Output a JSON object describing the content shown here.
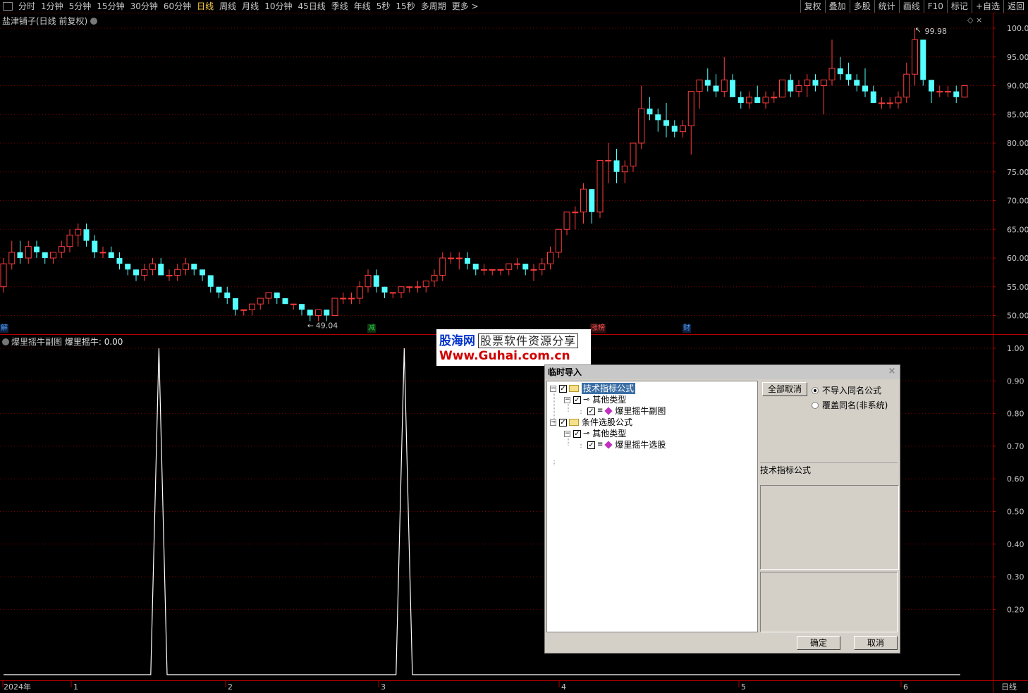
{
  "toolbar": {
    "periods": [
      "分时",
      "1分钟",
      "5分钟",
      "15分钟",
      "30分钟",
      "60分钟",
      "日线",
      "周线",
      "月线",
      "10分钟",
      "45日线",
      "季线",
      "年线",
      "5秒",
      "15秒",
      "多周期",
      "更多 >"
    ],
    "active_period": "日线",
    "right_buttons": [
      "复权",
      "叠加",
      "多股",
      "统计",
      "画线",
      "F10",
      "标记",
      "+自选",
      "返回"
    ]
  },
  "main_chart": {
    "title": "盐津铺子(日线 前复权)",
    "colors": {
      "up": "#ff3c3c",
      "down": "#54ffff",
      "grid": "#7a0000",
      "axis_line": "#b00000"
    },
    "y_ticks": [
      "100.0",
      "95.00",
      "90.00",
      "85.00",
      "80.00",
      "75.00",
      "70.00",
      "65.00",
      "60.00",
      "55.00",
      "50.00"
    ],
    "high_label": "99.98",
    "low_label": "49.04",
    "markers": [
      {
        "text": "解",
        "color": "#4aa0ff"
      },
      {
        "text": "减",
        "color": "#22cc44"
      },
      {
        "text": "涨榜",
        "color": "#ff5050"
      },
      {
        "text": "财",
        "color": "#4aa0ff"
      }
    ]
  },
  "chart_data": [
    {
      "type": "candlestick",
      "title": "盐津铺子(日线 前复权)",
      "ylim": [
        46,
        101
      ],
      "candles_ohlc": [
        [
          55,
          60,
          54,
          59
        ],
        [
          59,
          63,
          58,
          61
        ],
        [
          61,
          63,
          59,
          60
        ],
        [
          60,
          63,
          59,
          62
        ],
        [
          62,
          63,
          60,
          61
        ],
        [
          61,
          61,
          59,
          60
        ],
        [
          60,
          61,
          59,
          61
        ],
        [
          61,
          63,
          60,
          62
        ],
        [
          62,
          65,
          61,
          64
        ],
        [
          64,
          66,
          62,
          65
        ],
        [
          65,
          66,
          62,
          63
        ],
        [
          63,
          64,
          60,
          61
        ],
        [
          61,
          62,
          60,
          61
        ],
        [
          61,
          62,
          60,
          60
        ],
        [
          60,
          61,
          58,
          59
        ],
        [
          59,
          59,
          57,
          58
        ],
        [
          58,
          58,
          56,
          57
        ],
        [
          57,
          59,
          56,
          58
        ],
        [
          58,
          60,
          57,
          59
        ],
        [
          59,
          60,
          57,
          57
        ],
        [
          57,
          58,
          56,
          57
        ],
        [
          57,
          59,
          56,
          58
        ],
        [
          58,
          60,
          57,
          59
        ],
        [
          59,
          59,
          57,
          58
        ],
        [
          58,
          58,
          56,
          57
        ],
        [
          57,
          57,
          54,
          55
        ],
        [
          55,
          55,
          53,
          54
        ],
        [
          54,
          55,
          52,
          53
        ],
        [
          53,
          53,
          50,
          51
        ],
        [
          51,
          51,
          50,
          51
        ],
        [
          51,
          52,
          50,
          52
        ],
        [
          52,
          53,
          51,
          53
        ],
        [
          53,
          54,
          52,
          54
        ],
        [
          54,
          54,
          52,
          53
        ],
        [
          53,
          53,
          52,
          52
        ],
        [
          52,
          52,
          51,
          52
        ],
        [
          52,
          52,
          50,
          51
        ],
        [
          51,
          51,
          49,
          50
        ],
        [
          50,
          51,
          49,
          51
        ],
        [
          51,
          51,
          49,
          50
        ],
        [
          50,
          53,
          50,
          53
        ],
        [
          53,
          54,
          52,
          53
        ],
        [
          53,
          54,
          52,
          53
        ],
        [
          53,
          56,
          52,
          55
        ],
        [
          55,
          58,
          54,
          57
        ],
        [
          57,
          58,
          54,
          55
        ],
        [
          55,
          55,
          53,
          54
        ],
        [
          54,
          54,
          53,
          54
        ],
        [
          54,
          55,
          53,
          55
        ],
        [
          55,
          55,
          54,
          55
        ],
        [
          55,
          56,
          54,
          55
        ],
        [
          55,
          56,
          54,
          56
        ],
        [
          56,
          58,
          55,
          57
        ],
        [
          57,
          61,
          56,
          60
        ],
        [
          60,
          61,
          59,
          60
        ],
        [
          60,
          61,
          58,
          60
        ],
        [
          60,
          61,
          58,
          59
        ],
        [
          59,
          59,
          57,
          58
        ],
        [
          58,
          59,
          57,
          58
        ],
        [
          58,
          58,
          57,
          58
        ],
        [
          58,
          58,
          57,
          58
        ],
        [
          58,
          59,
          57,
          59
        ],
        [
          59,
          60,
          58,
          59
        ],
        [
          59,
          59,
          57,
          58
        ],
        [
          58,
          59,
          56,
          58
        ],
        [
          58,
          60,
          57,
          59
        ],
        [
          59,
          62,
          58,
          61
        ],
        [
          61,
          65,
          60,
          65
        ],
        [
          65,
          68,
          64,
          68
        ],
        [
          68,
          69,
          65,
          68
        ],
        [
          68,
          73,
          66,
          72
        ],
        [
          72,
          72,
          66,
          68
        ],
        [
          68,
          77,
          67,
          77
        ],
        [
          77,
          80,
          73,
          77
        ],
        [
          77,
          79,
          73,
          75
        ],
        [
          75,
          77,
          73,
          76
        ],
        [
          76,
          80,
          75,
          80
        ],
        [
          80,
          90,
          79,
          86
        ],
        [
          86,
          88,
          84,
          85
        ],
        [
          85,
          86,
          82,
          84
        ],
        [
          84,
          87,
          81,
          83
        ],
        [
          83,
          84,
          81,
          82
        ],
        [
          82,
          84,
          81,
          83
        ],
        [
          83,
          89,
          78,
          89
        ],
        [
          89,
          91,
          86,
          91
        ],
        [
          91,
          93,
          89,
          90
        ],
        [
          90,
          92,
          88,
          89
        ],
        [
          89,
          95,
          88,
          91
        ],
        [
          91,
          92,
          88,
          88
        ],
        [
          88,
          89,
          86,
          87
        ],
        [
          87,
          89,
          86,
          88
        ],
        [
          88,
          90,
          87,
          87
        ],
        [
          87,
          89,
          86,
          88
        ],
        [
          88,
          89,
          87,
          88
        ],
        [
          88,
          91,
          88,
          91
        ],
        [
          91,
          92,
          88,
          89
        ],
        [
          89,
          91,
          88,
          90
        ],
        [
          90,
          92,
          88,
          91
        ],
        [
          91,
          92,
          89,
          90
        ],
        [
          90,
          91,
          85,
          91
        ],
        [
          91,
          98,
          90,
          93
        ],
        [
          93,
          95,
          91,
          92
        ],
        [
          92,
          94,
          90,
          91
        ],
        [
          91,
          92,
          89,
          90
        ],
        [
          90,
          93,
          88,
          89
        ],
        [
          89,
          90,
          87,
          87
        ],
        [
          87,
          88,
          86,
          87
        ],
        [
          87,
          88,
          86,
          87
        ],
        [
          87,
          89,
          86,
          88
        ],
        [
          88,
          94,
          87,
          92
        ],
        [
          92,
          100,
          90,
          98
        ],
        [
          98,
          98,
          90,
          91
        ],
        [
          91,
          91,
          87,
          89
        ],
        [
          89,
          90,
          88,
          89
        ],
        [
          89,
          90,
          88,
          89
        ],
        [
          89,
          90,
          87,
          88
        ],
        [
          88,
          90,
          88,
          90
        ]
      ]
    },
    {
      "type": "line",
      "title": "爆里摇牛副图",
      "series": [
        {
          "name": "爆里摇牛",
          "values": [
            0,
            0,
            0,
            0,
            0,
            0,
            0,
            0,
            0,
            0,
            0,
            0,
            0,
            0,
            0,
            0,
            0,
            0,
            0,
            1,
            0,
            0,
            0,
            0,
            0,
            0,
            0,
            0,
            0,
            0,
            0,
            0,
            0,
            0,
            0,
            0,
            0,
            0,
            0,
            0,
            0,
            0,
            0,
            0,
            0,
            0,
            0,
            0,
            0,
            1,
            0,
            0,
            0,
            0,
            0,
            0,
            0,
            0,
            0,
            0,
            0,
            0,
            0,
            0,
            0,
            0,
            0,
            0,
            0,
            0,
            0,
            0,
            0,
            0,
            0,
            0,
            0,
            0,
            0,
            0,
            0,
            0,
            0,
            0,
            0,
            0,
            0,
            0,
            0,
            0,
            0,
            0,
            0,
            0,
            0,
            0,
            0,
            0,
            0,
            0,
            0,
            0,
            0,
            0,
            0,
            0,
            0,
            0,
            0,
            0,
            0,
            0,
            0,
            0,
            0,
            0,
            0,
            0
          ]
        }
      ],
      "ylim": [
        0,
        1
      ],
      "y_ticks": [
        "1.00",
        "0.90",
        "0.80",
        "0.70",
        "0.60",
        "0.50",
        "0.40",
        "0.30",
        "0.20"
      ]
    }
  ],
  "sub_chart": {
    "title": "爆里摇牛副图",
    "value_label": "爆里摇牛: 0.00"
  },
  "x_axis": {
    "labels": [
      "2024年",
      "1",
      "2",
      "3",
      "4",
      "5",
      "6"
    ],
    "period_label": "日线"
  },
  "watermark": {
    "line1_brand": "股海网",
    "line1_tag": "股票软件资源分享",
    "line2": "Www.Guhai.com.cn"
  },
  "dialog": {
    "title": "临时导入",
    "tree": [
      {
        "label": "技术指标公式",
        "level": 0,
        "type": "folder",
        "checked": true,
        "selected": true
      },
      {
        "label": "其他类型",
        "level": 1,
        "type": "key",
        "checked": true
      },
      {
        "label": "爆里摇牛副图",
        "level": 2,
        "type": "item",
        "checked": true
      },
      {
        "label": "条件选股公式",
        "level": 0,
        "type": "folder",
        "checked": true
      },
      {
        "label": "其他类型",
        "level": 1,
        "type": "key",
        "checked": true
      },
      {
        "label": "爆里摇牛选股",
        "level": 2,
        "type": "item",
        "checked": true
      }
    ],
    "cancel_all_button": "全部取消",
    "radio_options": [
      {
        "label": "不导入同名公式",
        "selected": true
      },
      {
        "label": "覆盖同名(非系统)",
        "selected": false
      }
    ],
    "description_title": "技术指标公式",
    "ok_button": "确定",
    "cancel_button": "取消"
  }
}
